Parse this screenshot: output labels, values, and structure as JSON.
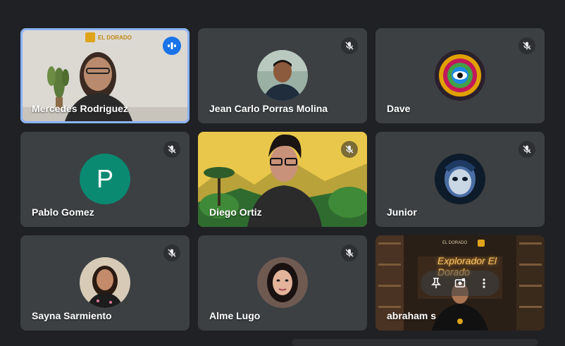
{
  "participants": [
    {
      "name": "Mercedes Rodriguez",
      "status": "speaking",
      "logo_text": "EL DORADO"
    },
    {
      "name": "Jean Carlo Porras Molina",
      "status": "muted"
    },
    {
      "name": "Dave",
      "status": "muted"
    },
    {
      "name": "Pablo Gomez",
      "status": "muted",
      "initial": "P"
    },
    {
      "name": "Diego Ortiz",
      "status": "muted"
    },
    {
      "name": "Junior",
      "status": "muted"
    },
    {
      "name": "Sayna Sarmiento",
      "status": "muted"
    },
    {
      "name": "Alme Lugo",
      "status": "muted"
    },
    {
      "name": "abraham s",
      "status": "video",
      "logo_text": "EL DORADO",
      "sign_text": "Explorador El Dorado"
    }
  ],
  "colors": {
    "background": "#202124",
    "tile": "#3c4043",
    "active_border": "#8ab4f8",
    "speaking_badge": "#1a73e8",
    "letter_avatar": "#0b8a72"
  },
  "icons": {
    "muted": "mic-off-icon",
    "speaking": "audio-level-icon",
    "pin": "pin-icon",
    "frame": "frame-icon",
    "more": "more-vert-icon"
  }
}
